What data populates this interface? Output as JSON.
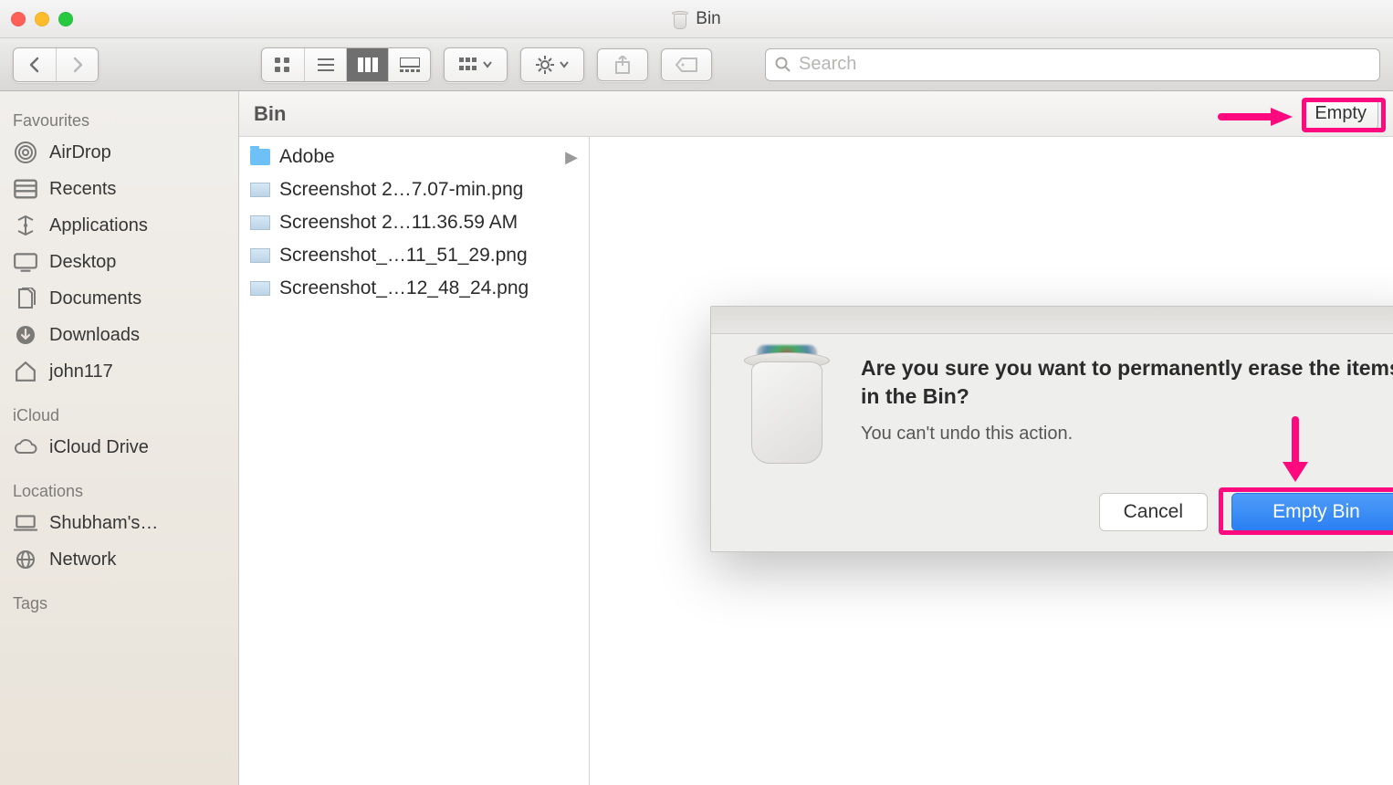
{
  "window": {
    "title": "Bin"
  },
  "toolbar": {
    "search_placeholder": "Search"
  },
  "sidebar": {
    "sections": [
      {
        "title": "Favourites",
        "items": [
          {
            "label": "AirDrop",
            "icon": "airdrop"
          },
          {
            "label": "Recents",
            "icon": "recents"
          },
          {
            "label": "Applications",
            "icon": "applications"
          },
          {
            "label": "Desktop",
            "icon": "desktop"
          },
          {
            "label": "Documents",
            "icon": "documents"
          },
          {
            "label": "Downloads",
            "icon": "downloads"
          },
          {
            "label": "john117",
            "icon": "home"
          }
        ]
      },
      {
        "title": "iCloud",
        "items": [
          {
            "label": "iCloud Drive",
            "icon": "cloud"
          }
        ]
      },
      {
        "title": "Locations",
        "items": [
          {
            "label": "Shubham's…",
            "icon": "laptop"
          },
          {
            "label": "Network",
            "icon": "network"
          }
        ]
      },
      {
        "title": "Tags",
        "items": []
      }
    ]
  },
  "location": {
    "name": "Bin",
    "empty_label": "Empty"
  },
  "files": [
    {
      "name": "Adobe",
      "type": "folder"
    },
    {
      "name": "Screenshot 2…7.07-min.png",
      "type": "image"
    },
    {
      "name": "Screenshot 2…11.36.59 AM",
      "type": "image"
    },
    {
      "name": "Screenshot_…11_51_29.png",
      "type": "image"
    },
    {
      "name": "Screenshot_…12_48_24.png",
      "type": "image"
    }
  ],
  "dialog": {
    "heading": "Are you sure you want to permanently erase the items in the Bin?",
    "body": "You can't undo this action.",
    "cancel": "Cancel",
    "confirm": "Empty Bin"
  }
}
